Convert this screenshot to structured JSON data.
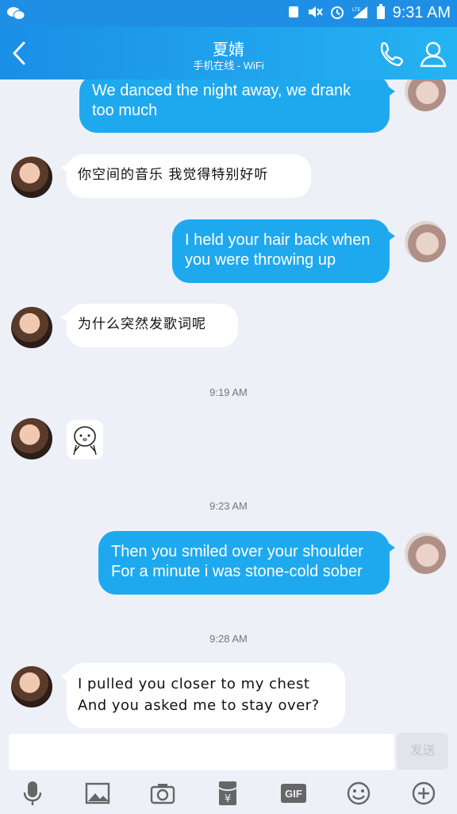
{
  "status_bar": {
    "time": "9:31 AM",
    "lte_label": "LTE"
  },
  "header": {
    "title": "夏婧",
    "subtitle": "手机在线 - WiFi"
  },
  "messages": [
    {
      "text": "We danced the night away, we drank too much"
    },
    {
      "text": "你空间的音乐 我觉得特别好听"
    },
    {
      "text": "I held your hair back when you were throwing up"
    },
    {
      "text": "为什么突然发歌词呢"
    },
    {
      "timestamp": "9:19 AM"
    },
    {
      "timestamp": "9:23 AM"
    },
    {
      "text": "Then you smiled over your shoulder For a minute i was stone-cold sober"
    },
    {
      "timestamp": "9:28 AM"
    },
    {
      "text": "I pulled you closer to my chest And you asked me to stay over?"
    }
  ],
  "composer": {
    "input_value": "",
    "send_label": "发送"
  },
  "toolbar": {
    "gif_label": "GIF",
    "yen_label": "¥"
  },
  "icons": [
    "wechat-icon",
    "back-icon",
    "phone-icon",
    "profile-icon",
    "mic-icon",
    "image-icon",
    "camera-icon",
    "red-packet-icon",
    "gif-icon",
    "emoji-icon",
    "plus-icon"
  ]
}
